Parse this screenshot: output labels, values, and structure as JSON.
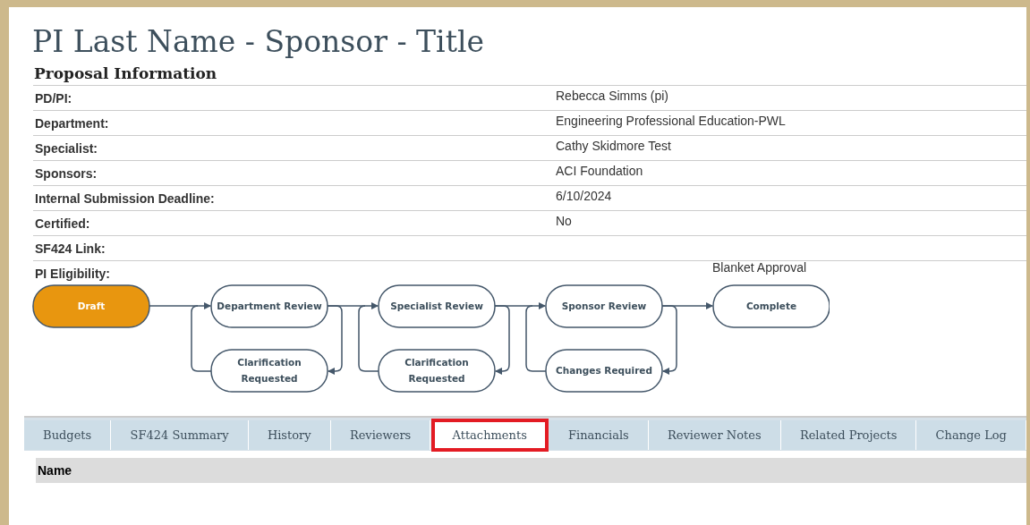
{
  "title": "PI Last Name - Sponsor - Title",
  "section_title": "Proposal Information",
  "fields": [
    {
      "label": "PD/PI:",
      "value": "Rebecca Simms (pi)"
    },
    {
      "label": "Department:",
      "value": "Engineering Professional Education-PWL"
    },
    {
      "label": "Specialist:",
      "value": "Cathy Skidmore Test"
    },
    {
      "label": "Sponsors:",
      "value": "ACI Foundation"
    },
    {
      "label": "Internal Submission Deadline:",
      "value": "6/10/2024"
    },
    {
      "label": "Certified:",
      "value": "No"
    },
    {
      "label": "SF424 Link:"
    },
    {
      "label": "PI Eligibility:",
      "value": "Blanket Approval"
    }
  ],
  "workflow": [
    {
      "label": "Draft",
      "current": true
    },
    {
      "label": "Department Review",
      "current": false,
      "return": "Clarification Requested"
    },
    {
      "label": "Specialist Review",
      "current": false,
      "return": "Clarification Requested"
    },
    {
      "label": "Sponsor Review",
      "current": false,
      "return": "Changes Required"
    },
    {
      "label": "Complete",
      "current": false
    }
  ],
  "tabs": [
    {
      "label": "Budgets",
      "selected": false
    },
    {
      "label": "SF424 Summary",
      "selected": false
    },
    {
      "label": "History",
      "selected": false
    },
    {
      "label": "Reviewers",
      "selected": false
    },
    {
      "label": "Attachments",
      "selected": true
    },
    {
      "label": "Financials",
      "selected": false
    },
    {
      "label": "Reviewer Notes",
      "selected": false
    },
    {
      "label": "Related Projects",
      "selected": false
    },
    {
      "label": "Change Log",
      "selected": false
    }
  ],
  "table": {
    "columns": [
      "Name"
    ]
  }
}
